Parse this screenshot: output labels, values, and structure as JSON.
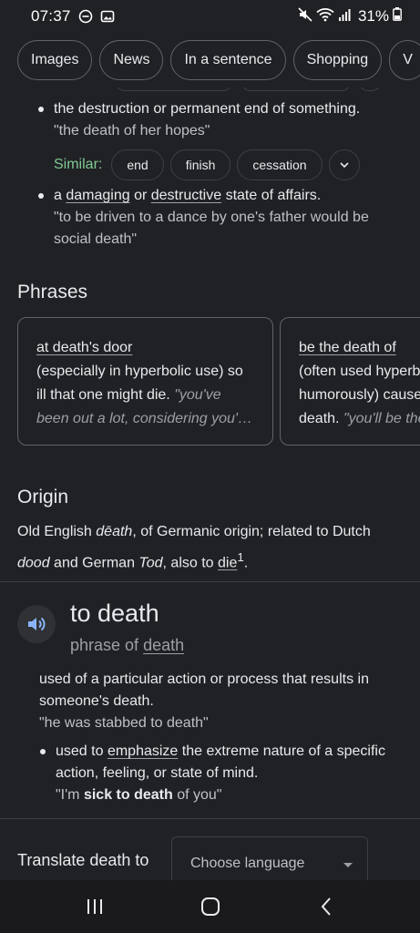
{
  "status_bar": {
    "time": "07:37",
    "battery": "31%"
  },
  "chips": [
    {
      "label": "Images"
    },
    {
      "label": "News"
    },
    {
      "label": "In a sentence"
    },
    {
      "label": "Shopping"
    },
    {
      "label": "V"
    }
  ],
  "definitions": {
    "def2": {
      "text": "the destruction or permanent end of something.",
      "example": "\"the death of her hopes\""
    },
    "similar": {
      "label": "Similar:",
      "items": [
        "end",
        "finish",
        "cessation"
      ]
    },
    "def3": {
      "pre": "a ",
      "link1": "damaging",
      "mid": " or ",
      "link2": "destructive",
      "post": " state of affairs.",
      "example": "\"to be driven to a dance by one's father would be social death\""
    }
  },
  "phrases": {
    "title": "Phrases",
    "cards": [
      {
        "title": "at death's door",
        "text": "(especially in hyperbolic use) so ill that one might die. ",
        "example": "\"you've been out a lot, considering you'…"
      },
      {
        "title": "be the death of",
        "text": "(often used hyperbolically or humorously) cause someone's death. ",
        "example": "\"you'll be the th"
      }
    ]
  },
  "origin": {
    "title": "Origin",
    "t1": "Old English ",
    "word1": "dēath",
    "t2": ", of Germanic origin; related to Dutch ",
    "word2": "dood",
    "t3": " and German ",
    "word3": "Tod",
    "t4": ", also to ",
    "link": "die",
    "sup": "1",
    "t5": "."
  },
  "entry": {
    "headword": "to death",
    "pos_pre": "phrase of ",
    "pos_link": "death",
    "sense1": {
      "text": "used of a particular action or process that results in someone's death.",
      "example": "\"he was stabbed to death\""
    },
    "sense2": {
      "pre": "used to ",
      "link": "emphasize",
      "post": " the extreme nature of a specific action, feeling, or state of mind.",
      "ex_pre": "\"I'm ",
      "ex_bold": "sick to death",
      "ex_post": " of you\""
    }
  },
  "translate": {
    "label": "Translate death to",
    "placeholder": "Choose language"
  }
}
